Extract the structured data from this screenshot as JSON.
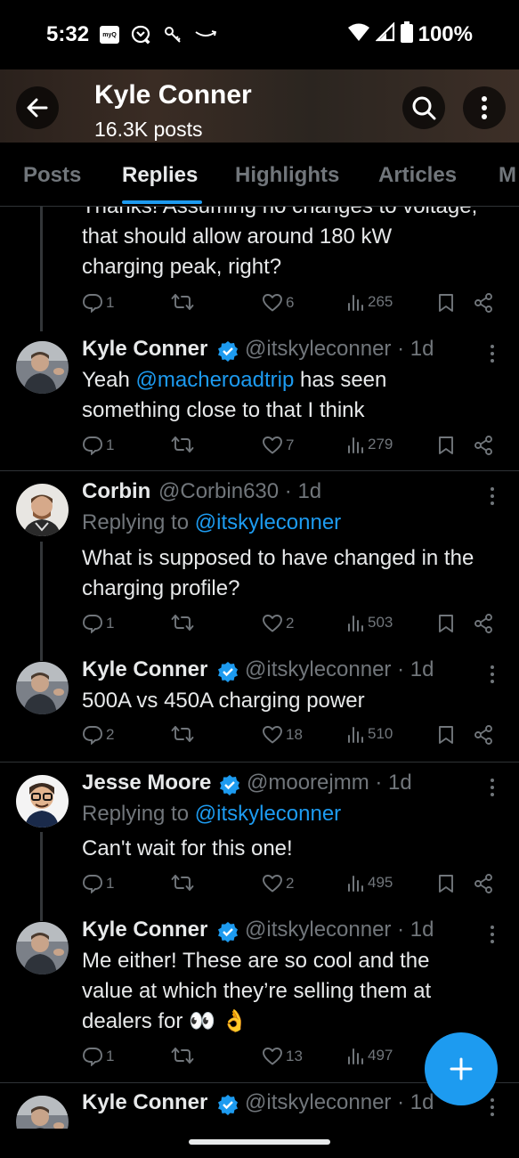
{
  "status_bar": {
    "time": "5:32",
    "myq_label": "myQ",
    "battery": "100%"
  },
  "header": {
    "title": "Kyle Conner",
    "subtitle": "16.3K posts"
  },
  "tabs": [
    "Posts",
    "Replies",
    "Highlights",
    "Articles",
    "M"
  ],
  "active_tab": "Replies",
  "posts": [
    {
      "partial": true,
      "text_lines": [
        "Thanks! Assuming no changes to voltage,",
        "that should allow around 180 kW",
        "charging peak, right?"
      ],
      "replies": "1",
      "reposts": "",
      "likes": "6",
      "views": "265"
    },
    {
      "name": "Kyle Conner",
      "verified": true,
      "handle": "@itskyleconner",
      "time": "1d",
      "text_prefix": "Yeah ",
      "mention": "@macheroadtrip",
      "text_suffix": " has seen",
      "text_line2": "something close to that I think",
      "replies": "1",
      "reposts": "",
      "likes": "7",
      "views": "279"
    },
    {
      "name": "Corbin",
      "verified": false,
      "handle": "@Corbin630",
      "time": "1d",
      "replying_label": "Replying to ",
      "replying_handle": "@itskyleconner",
      "text_lines": [
        "What is supposed to have changed in the",
        "charging profile?"
      ],
      "replies": "1",
      "reposts": "",
      "likes": "2",
      "views": "503"
    },
    {
      "name": "Kyle Conner",
      "verified": true,
      "handle": "@itskyleconner",
      "time": "1d",
      "text_lines": [
        "500A vs 450A charging power"
      ],
      "replies": "2",
      "reposts": "",
      "likes": "18",
      "views": "510"
    },
    {
      "name": "Jesse Moore",
      "verified": true,
      "handle": "@moorejmm",
      "time": "1d",
      "replying_label": "Replying to ",
      "replying_handle": "@itskyleconner",
      "text_lines": [
        "Can't wait for this one!"
      ],
      "replies": "1",
      "reposts": "",
      "likes": "2",
      "views": "495"
    },
    {
      "name": "Kyle Conner",
      "verified": true,
      "handle": "@itskyleconner",
      "time": "1d",
      "text_lines": [
        "Me either! These are so cool and the",
        "value at which they’re selling them at",
        "dealers for 👀 👌"
      ],
      "replies": "1",
      "reposts": "",
      "likes": "13",
      "views": "497"
    },
    {
      "name": "Kyle Conner",
      "verified": true,
      "handle": "@itskyleconner",
      "time": "1d"
    }
  ],
  "colors": {
    "accent": "#1d9bf0",
    "secondary_text": "#71767b",
    "divider": "#2f3336"
  }
}
